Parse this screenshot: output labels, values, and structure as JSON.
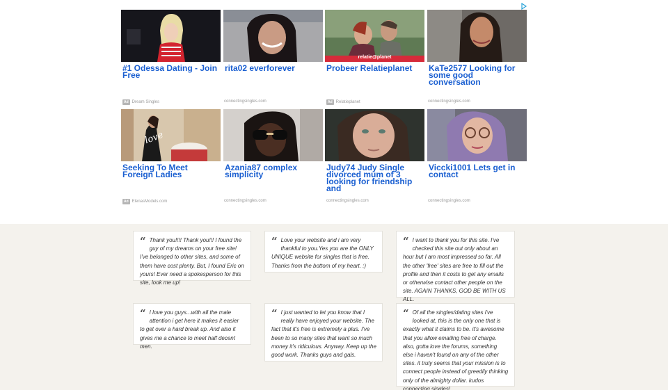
{
  "ads": {
    "adchoices_icon": "adchoices-icon",
    "badge": "Ad",
    "items": [
      {
        "title": "#1 Odessa Dating - Join Free",
        "source": "Dream Singles",
        "ad_badge": true
      },
      {
        "title": "rita02 everforever",
        "source": "connectingsingles.com",
        "ad_badge": false
      },
      {
        "title": "Probeer Relatieplanet",
        "source": "Relatieplanet",
        "ad_badge": true,
        "image_caption": "relatie@planet"
      },
      {
        "title": "KaTe2577 Looking for some good conversation",
        "source": "connectingsingles.com",
        "ad_badge": false
      },
      {
        "title": "Seeking To Meet Foreign Ladies",
        "source": "ElenasModels.com",
        "ad_badge": true,
        "image_caption": "love"
      },
      {
        "title": "Azania87 complex simplicity",
        "source": "connectingsingles.com",
        "ad_badge": false
      },
      {
        "title": "Judy74 Judy Single divorced mum of 3 looking for friendship and",
        "source": "connectingsingles.com",
        "ad_badge": false
      },
      {
        "title": "Viccki1001 Lets get in contact",
        "source": "connectingsingles.com",
        "ad_badge": false
      }
    ]
  },
  "testimonials": {
    "quote_glyph": "“",
    "items": [
      "Thank you!!!! Thank you!!! I found the guy of my dreams on your free site! I've belonged to other sites, and some of them have cost plenty. But, I found Eric on yours! Ever need a spokesperson for this site, look me up!",
      "Love your website and i am very thankful to you.Yes you are the ONLY UNIQUE website for singles that is free. Thanks from the bottom of my heart. :)",
      "I want to thank you for this site. I've checked this site out only about an hour but I am most impressed so far. All the other 'free' sites are free to fill out the profile and then it costs to get any emails or otherwise contact other people on the site. AGAIN THANKS, GOD BE WITH US ALL.",
      "I love you guys...with all the male attention i get here it makes it easier to get over a hard break up. And also it gives me a chance to meet half decent men.",
      "I just wanted to let you know that I really have enjoyed your website. The fact that it's free is extremely a plus. I've been to so many sites that want so much money it's ridiculous. Anyway. Keep up the good work. Thanks guys and gals.",
      "Of all the singles/dating sites i've looked at, this is the only one that is exactly what it claims to be. it's awesome that you allow emailing free of charge. also, gotta love the forums, something else i haven't found on any of the other sites. it truly seems that your mission is to connect people instead of greedily thinking only of the almighty dollar. kudos connecting singles!"
    ]
  }
}
